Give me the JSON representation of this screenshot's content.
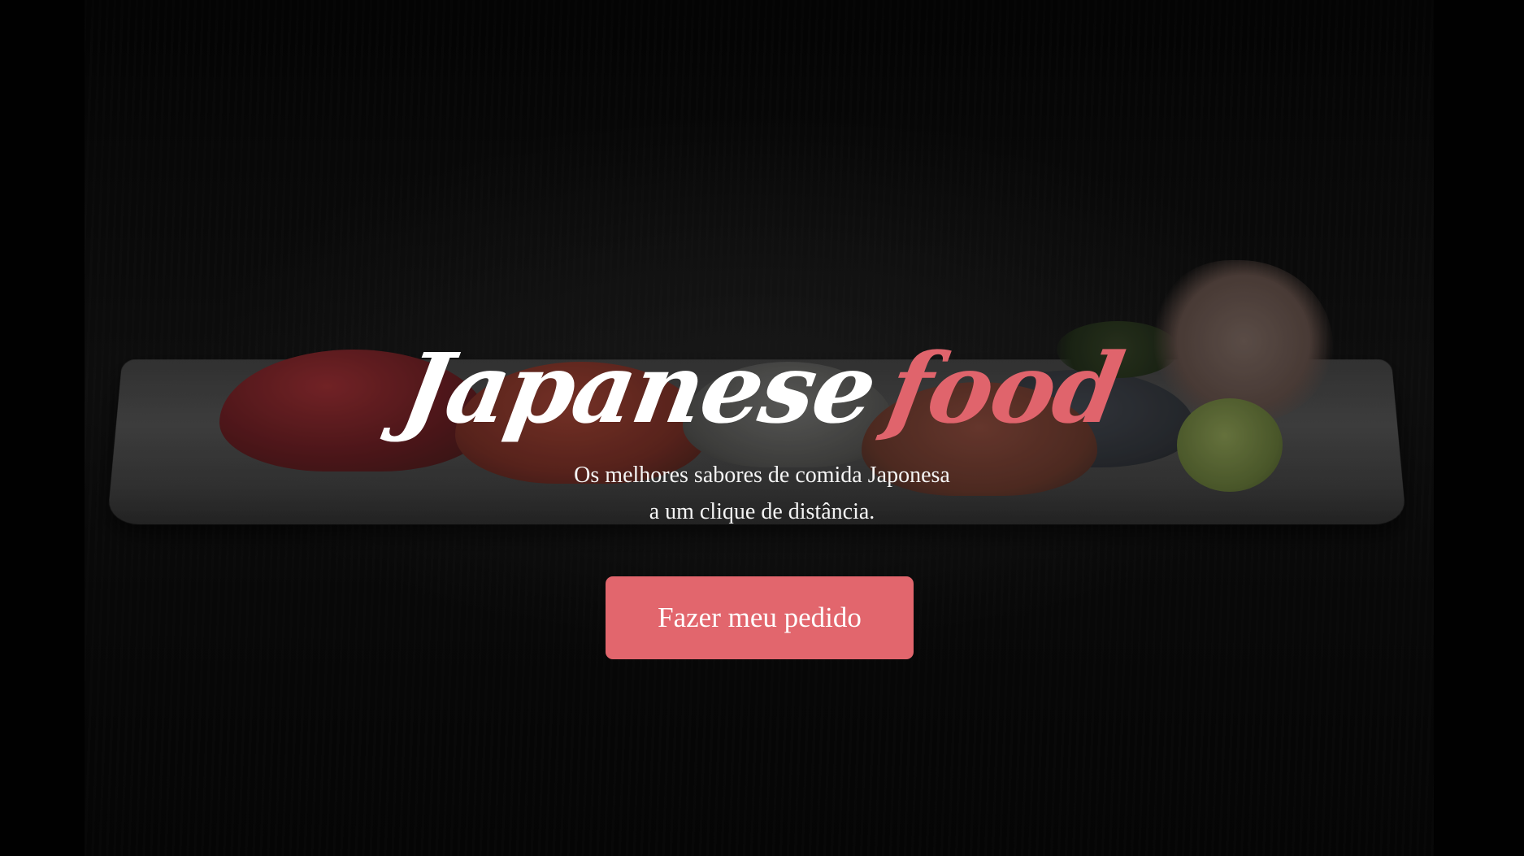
{
  "hero": {
    "title_main": "Japanese",
    "title_accent": "food",
    "subtitle_line1": "Os melhores sabores de comida Japonesa",
    "subtitle_line2": "a um clique de distância.",
    "cta_label": "Fazer meu pedido"
  },
  "colors": {
    "background": "#020202",
    "title_main": "#ffffff",
    "accent": "#e0646c",
    "button": "#e2666d",
    "button_text": "#ffffff",
    "subtitle": "#f4f4f4"
  }
}
